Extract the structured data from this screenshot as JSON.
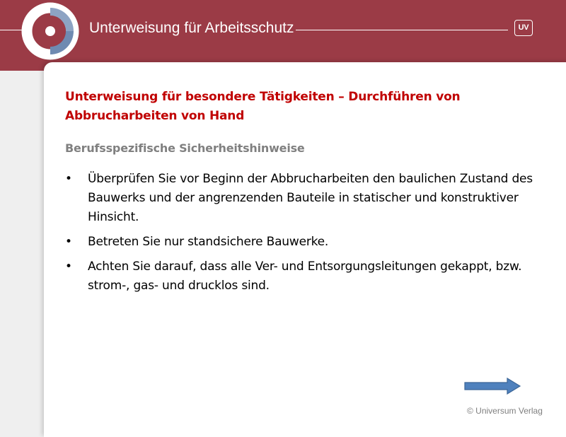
{
  "header": {
    "title": "Unterweisung für Arbeitsschutz",
    "badge": "UV",
    "background_color": "#9b3b46",
    "logo_icon": "ring-logo-icon"
  },
  "slide": {
    "heading": "Unterweisung für besondere Tätigkeiten – Durchführen von Abbrucharbeiten von Hand",
    "subheading": "Berufsspezifische Sicherheitshinweise",
    "heading_color": "#c00000",
    "subheading_color": "#808080",
    "bullets": [
      "Überprüfen Sie vor Beginn der Abbrucharbeiten den baulichen Zustand des Bauwerks und der angrenzenden Bauteile in statischer und konstruktiver Hinsicht.",
      "Betreten Sie nur standsichere Bauwerke.",
      "Achten Sie darauf, dass alle Ver- und Entsorgungsleitungen gekappt, bzw. strom-, gas- und drucklos sind."
    ],
    "bullet_symbol": "•"
  },
  "navigation": {
    "next_icon": "arrow-right-icon",
    "arrow_color": "#4f81bd"
  },
  "footer": {
    "copyright": "© Universum Verlag"
  }
}
